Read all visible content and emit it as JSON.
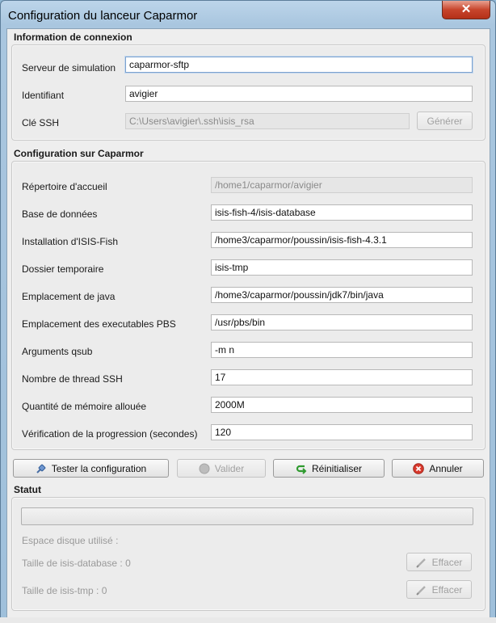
{
  "window": {
    "title": "Configuration du lanceur Caparmor",
    "close_glyph": "✕"
  },
  "connexion": {
    "section_title": "Information de connexion",
    "server_label": "Serveur de simulation",
    "server_value": "caparmor-sftp",
    "id_label": "Identifiant",
    "id_value": "avigier",
    "ssh_label": "Clé SSH",
    "ssh_value": "C:\\Users\\avigier\\.ssh\\isis_rsa",
    "generate_label": "Générer"
  },
  "config": {
    "section_title": "Configuration sur Caparmor",
    "rows": [
      {
        "label": "Répertoire d'accueil",
        "value": "/home1/caparmor/avigier",
        "disabled": true
      },
      {
        "label": "Base de données",
        "value": "isis-fish-4/isis-database",
        "disabled": false
      },
      {
        "label": "Installation d'ISIS-Fish",
        "value": "/home3/caparmor/poussin/isis-fish-4.3.1",
        "disabled": false
      },
      {
        "label": "Dossier temporaire",
        "value": "isis-tmp",
        "disabled": false
      },
      {
        "label": "Emplacement de java",
        "value": "/home3/caparmor/poussin/jdk7/bin/java",
        "disabled": false
      },
      {
        "label": "Emplacement des executables PBS",
        "value": "/usr/pbs/bin",
        "disabled": false
      },
      {
        "label": "Arguments qsub",
        "value": "-m n",
        "disabled": false
      },
      {
        "label": "Nombre de thread SSH",
        "value": "17",
        "disabled": false
      },
      {
        "label": "Quantité de mémoire allouée",
        "value": "2000M",
        "disabled": false
      },
      {
        "label": "Vérification de la progression (secondes)",
        "value": "120",
        "disabled": false
      }
    ]
  },
  "actions": {
    "test_label": "Tester la configuration",
    "validate_label": "Valider",
    "reset_label": "Réinitialiser",
    "cancel_label": "Annuler"
  },
  "status": {
    "section_title": "Statut",
    "progress": 0,
    "disk_label": "Espace disque utilisé :",
    "db_size_label": "Taille de isis-database : 0",
    "tmp_size_label": "Taille de isis-tmp : 0",
    "clear_label": "Effacer"
  },
  "colors": {
    "accent": "#3a76b8",
    "disabled_text": "#9a9a9a",
    "titlebar": "#a9c6df",
    "close": "#c7452c"
  }
}
